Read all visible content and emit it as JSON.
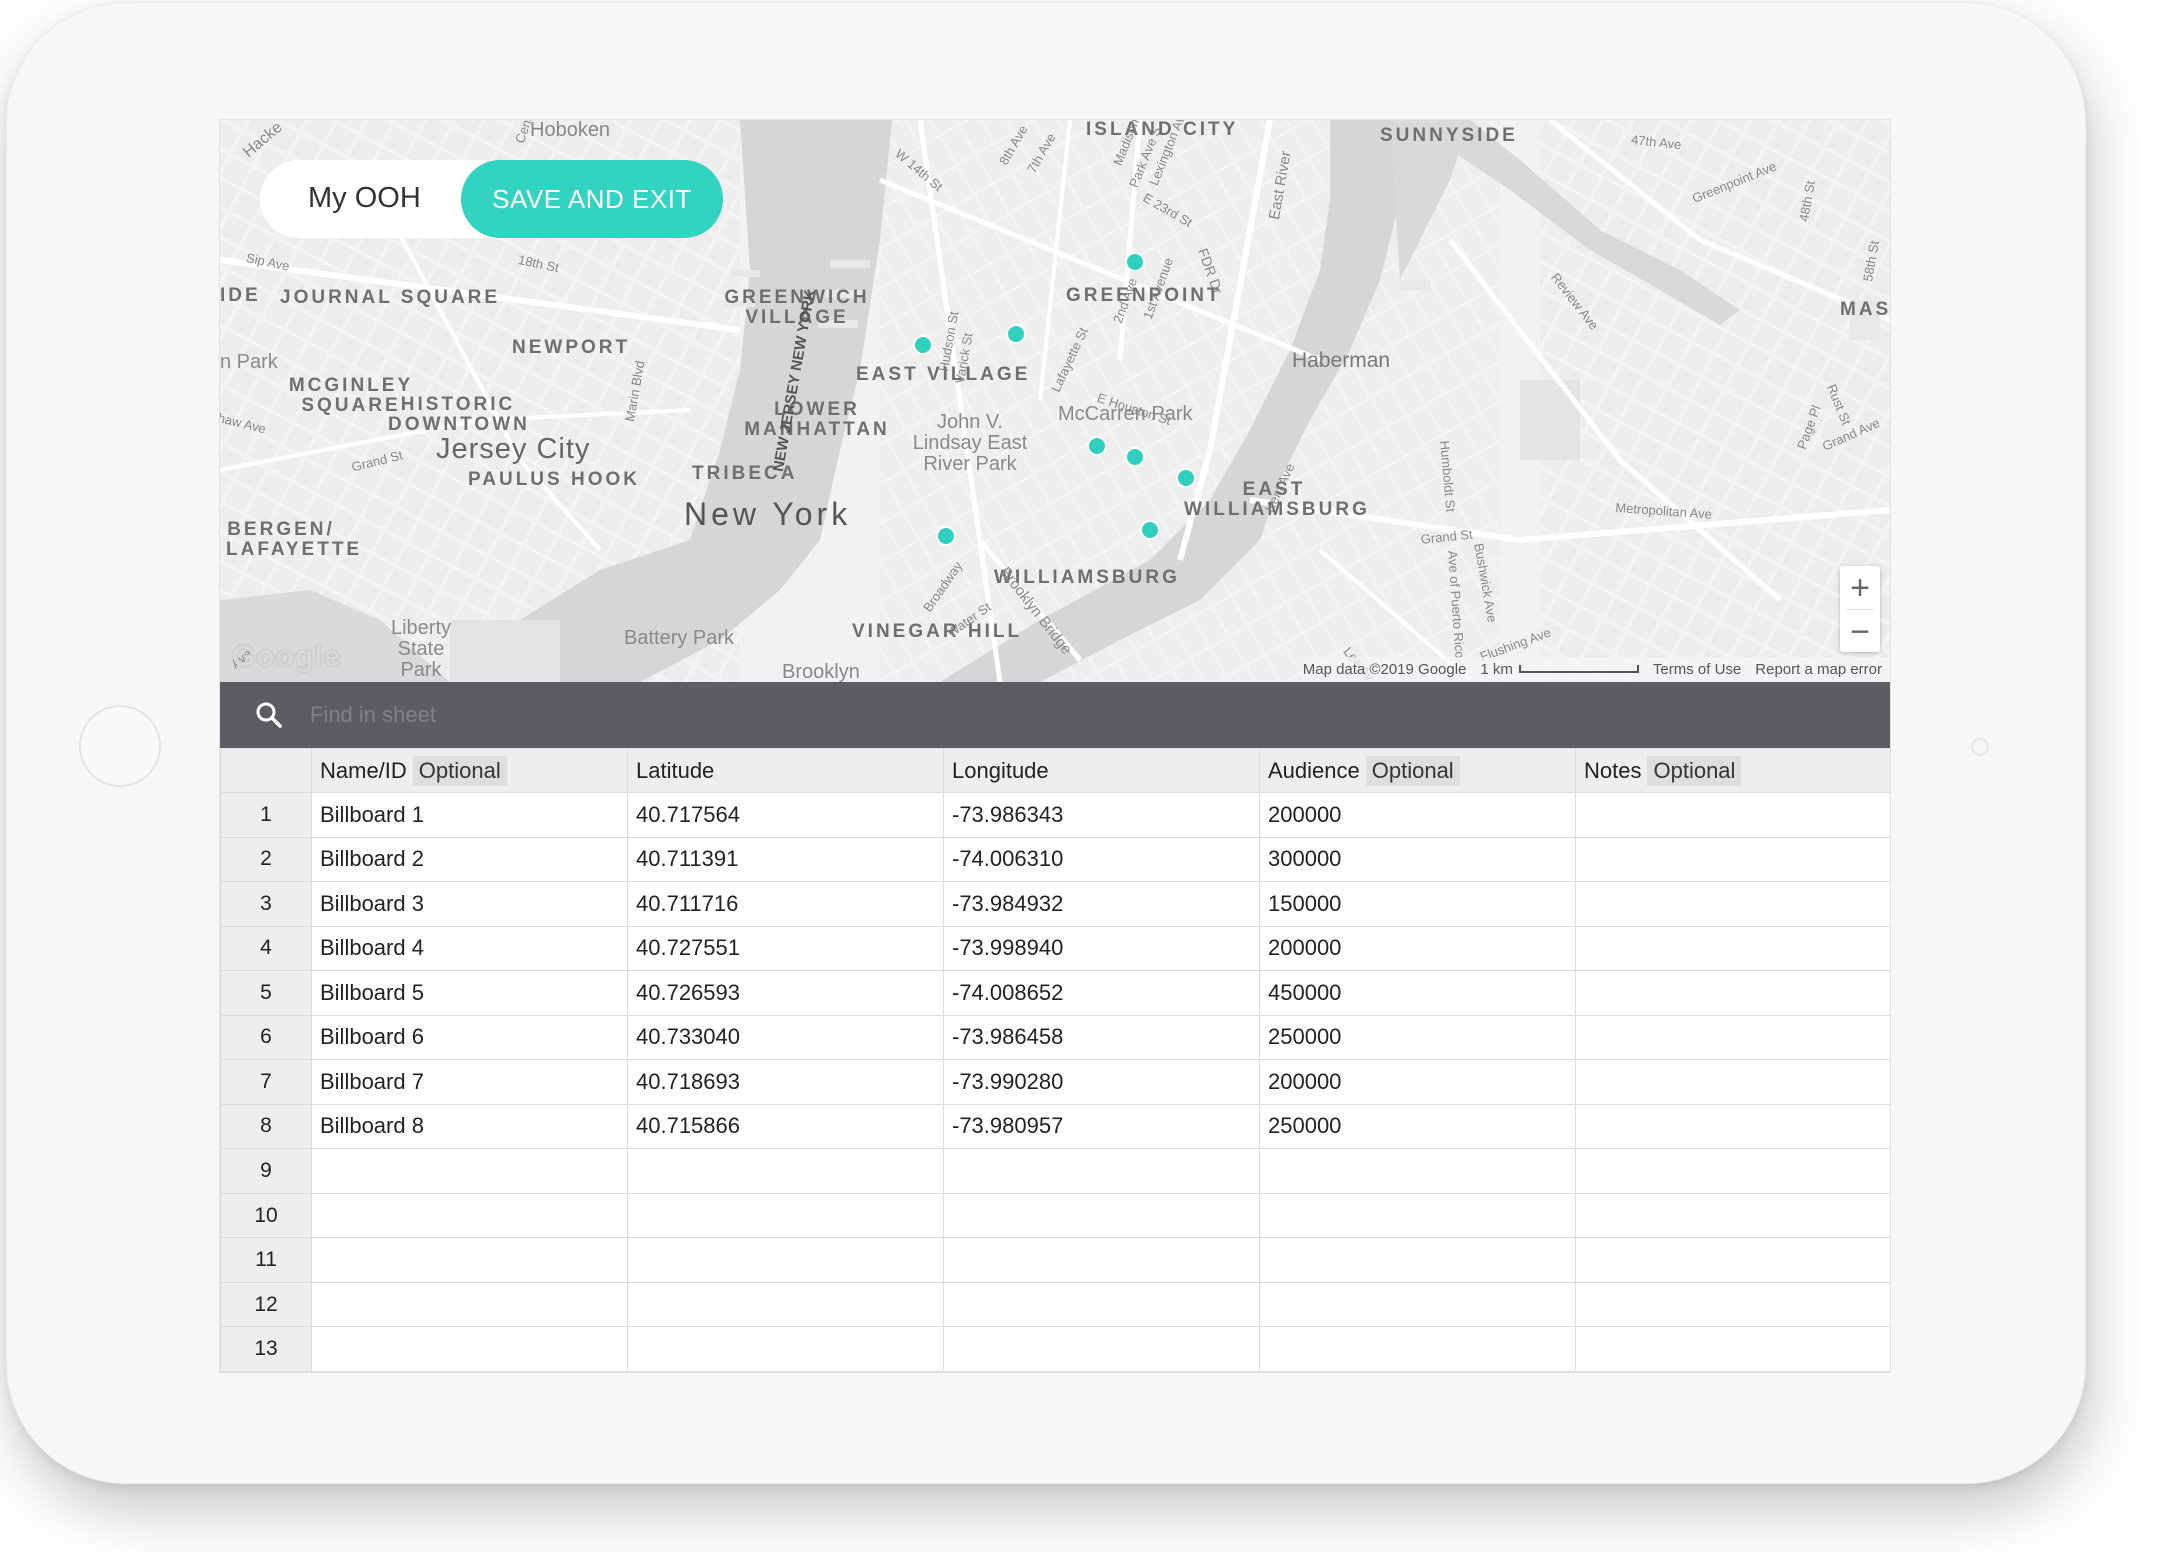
{
  "app": {
    "title": "My OOH",
    "save_exit_label": "SAVE AND EXIT"
  },
  "colors": {
    "accent": "#32d3c0",
    "search_bar": "#5c5d61",
    "marker": "#31d0be"
  },
  "map": {
    "neighborhood_labels": [
      "JOURNAL SQUARE",
      "NEWPORT",
      "MCGINLEY SQUARE",
      "HISTORIC DOWNTOWN",
      "PAULUS HOOK",
      "BERGEN/ LAFAYETTE",
      "GREENWICH VILLAGE",
      "EAST VILLAGE",
      "LOWER MANHATTAN",
      "TRIBECA",
      "VINEGAR HILL",
      "GREENPOINT",
      "ISLAND CITY",
      "SUNNYSIDE",
      "EAST WILLIAMSBURG",
      "WILLIAMSBURG",
      "MAS",
      "IDE"
    ],
    "city_labels": [
      "Jersey City",
      "New York",
      "Hoboken",
      "Haberman",
      "Brooklyn"
    ],
    "park_labels": [
      "Liberty State Park",
      "Battery Park",
      "McCarren Park",
      "John V. Lindsay East River Park",
      "n Park"
    ],
    "street_labels": [
      "Sip Ave",
      "18th St",
      "Grand St",
      "Marin Blvd",
      "NEW JERSEY NEW YORK",
      "W 14th St",
      "8th Ave",
      "7th Ave",
      "Madison",
      "Park Ave S",
      "Lexington Av",
      "E 23rd St",
      "Hudson St",
      "Varick St",
      "Lafayette St",
      "2nd Ave",
      "1st Avenue",
      "E Houston St",
      "FDR Dr",
      "East River",
      "Broadway",
      "Water St",
      "Brooklyn Bridge",
      "Kent Ave",
      "Humboldt St",
      "Grand St",
      "Bushwick Ave",
      "Ave of Puerto Rico",
      "Flushing Ave",
      "Metropolitan Ave",
      "Grand Ave",
      "Rust St",
      "Page Pl",
      "Review Ave",
      "48th St",
      "58th St",
      "47th Ave",
      "Greenpoint Ave",
      "Lee Av",
      "Hacke",
      "Cent",
      "Ave",
      "haw Ave"
    ],
    "google_logo": "Google",
    "map_data_text": "Map data ©2019 Google",
    "scale_text": "1 km",
    "terms_text": "Terms of Use",
    "report_text": "Report a map error",
    "zoom_in": "+",
    "zoom_out": "−"
  },
  "search": {
    "placeholder": "Find in sheet",
    "value": ""
  },
  "sheet": {
    "columns": [
      {
        "label": "Name/ID",
        "badge": "Optional"
      },
      {
        "label": "Latitude",
        "badge": ""
      },
      {
        "label": "Longitude",
        "badge": ""
      },
      {
        "label": "Audience",
        "badge": "Optional"
      },
      {
        "label": "Notes",
        "badge": "Optional"
      }
    ],
    "rows": [
      {
        "n": "1",
        "name": "Billboard 1",
        "lat": "40.717564",
        "lng": "-73.986343",
        "aud": "200000",
        "notes": ""
      },
      {
        "n": "2",
        "name": "Billboard 2",
        "lat": "40.711391",
        "lng": "-74.006310",
        "aud": "300000",
        "notes": ""
      },
      {
        "n": "3",
        "name": "Billboard 3",
        "lat": "40.711716",
        "lng": "-73.984932",
        "aud": "150000",
        "notes": ""
      },
      {
        "n": "4",
        "name": "Billboard 4",
        "lat": "40.727551",
        "lng": "-73.998940",
        "aud": "200000",
        "notes": ""
      },
      {
        "n": "5",
        "name": "Billboard 5",
        "lat": "40.726593",
        "lng": "-74.008652",
        "aud": "450000",
        "notes": ""
      },
      {
        "n": "6",
        "name": "Billboard 6",
        "lat": "40.733040",
        "lng": "-73.986458",
        "aud": "250000",
        "notes": ""
      },
      {
        "n": "7",
        "name": "Billboard 7",
        "lat": "40.718693",
        "lng": "-73.990280",
        "aud": "200000",
        "notes": ""
      },
      {
        "n": "8",
        "name": "Billboard 8",
        "lat": "40.715866",
        "lng": "-73.980957",
        "aud": "250000",
        "notes": ""
      },
      {
        "n": "9",
        "name": "",
        "lat": "",
        "lng": "",
        "aud": "",
        "notes": ""
      },
      {
        "n": "10",
        "name": "",
        "lat": "",
        "lng": "",
        "aud": "",
        "notes": ""
      },
      {
        "n": "11",
        "name": "",
        "lat": "",
        "lng": "",
        "aud": "",
        "notes": ""
      },
      {
        "n": "12",
        "name": "",
        "lat": "",
        "lng": "",
        "aud": "",
        "notes": ""
      },
      {
        "n": "13",
        "name": "",
        "lat": "",
        "lng": "",
        "aud": "",
        "notes": ""
      }
    ]
  }
}
